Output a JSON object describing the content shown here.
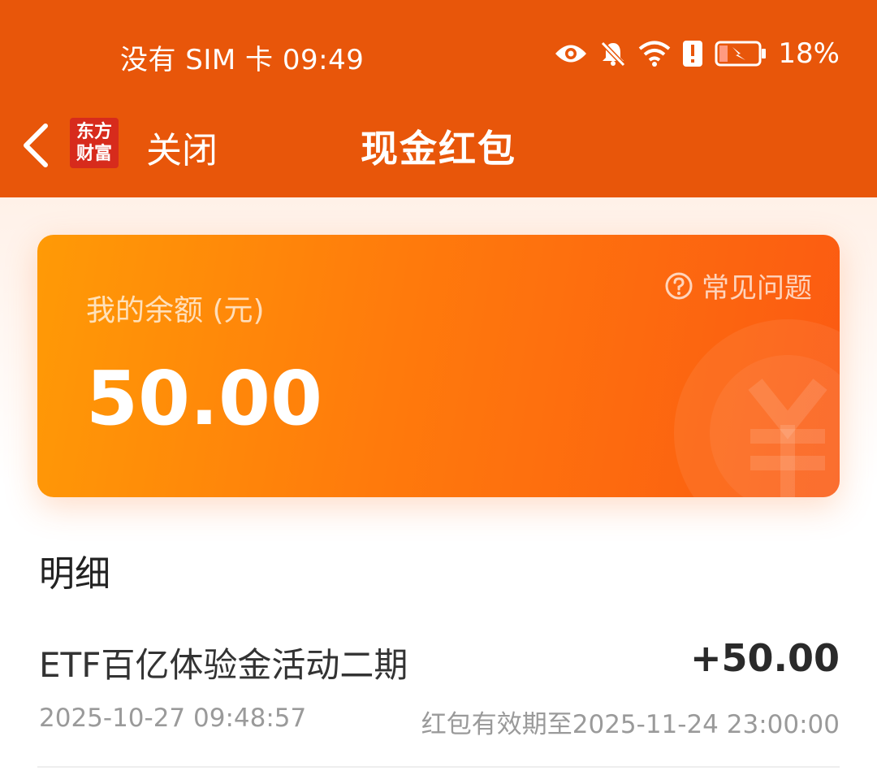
{
  "status_bar": {
    "carrier_time": "没有 SIM 卡 09:49",
    "battery_percent": "18%",
    "icons": [
      "eye-icon",
      "bell-off-icon",
      "wifi-icon",
      "alert-icon",
      "battery-icon"
    ]
  },
  "nav": {
    "logo_line1": "东方",
    "logo_line2": "财富",
    "close_label": "关闭",
    "title": "现金红包"
  },
  "balance_card": {
    "label": "我的余额 (元)",
    "amount": "50.00",
    "faq_label": "常见问题"
  },
  "details": {
    "heading": "明细",
    "items": [
      {
        "title": "ETF百亿体验金活动二期",
        "amount": "+50.00",
        "date": "2025-10-27 09:48:57",
        "expiry": "红包有效期至2025-11-24 23:00:00"
      }
    ]
  },
  "colors": {
    "header": "#e8560a",
    "card_start": "#ff9a06",
    "card_end": "#fb5a12"
  }
}
